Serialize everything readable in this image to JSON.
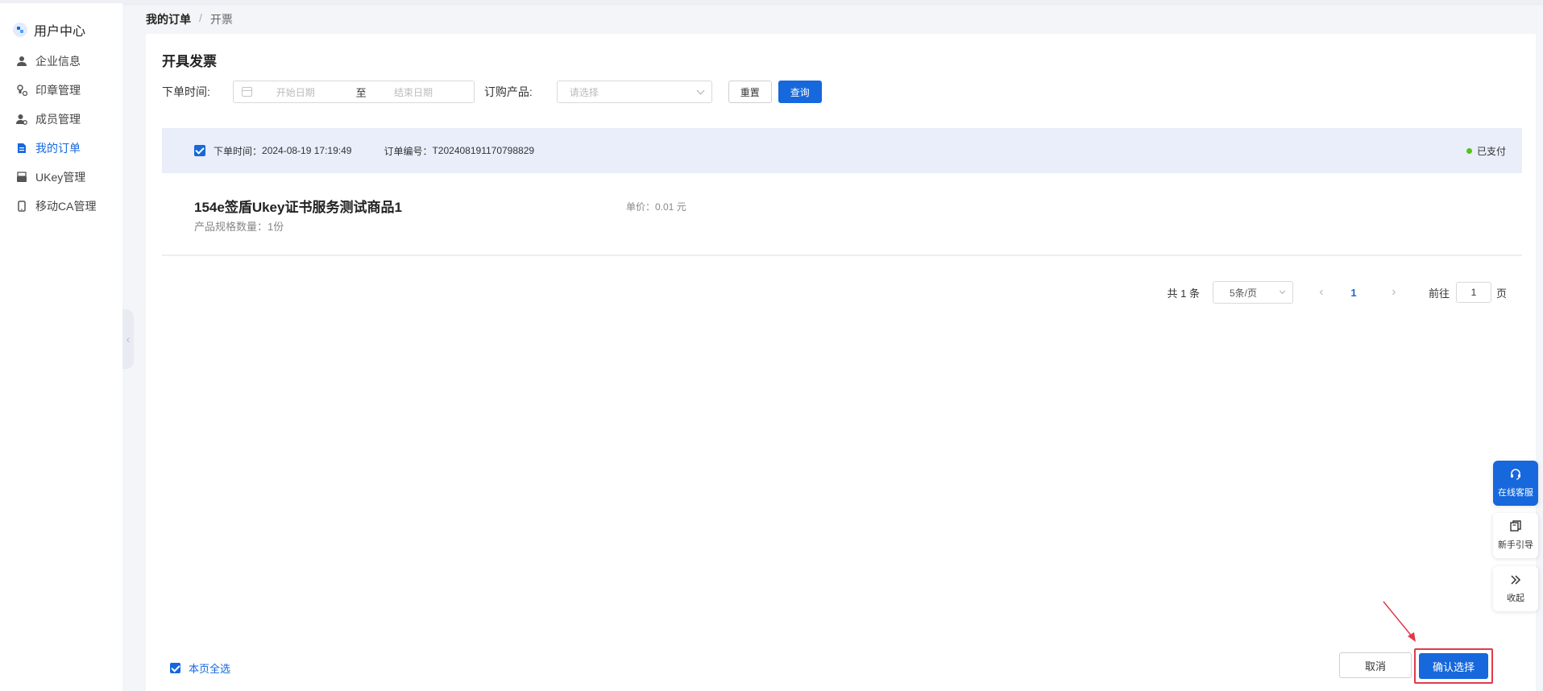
{
  "sidebar": {
    "title": "用户中心",
    "items": [
      {
        "label": "企业信息",
        "icon": "user-icon",
        "active": false
      },
      {
        "label": "印章管理",
        "icon": "seal-icon",
        "active": false
      },
      {
        "label": "成员管理",
        "icon": "members-icon",
        "active": false
      },
      {
        "label": "我的订单",
        "icon": "document-icon",
        "active": true
      },
      {
        "label": "UKey管理",
        "icon": "ukey-icon",
        "active": false
      },
      {
        "label": "移动CA管理",
        "icon": "mobile-icon",
        "active": false
      }
    ]
  },
  "breadcrumb": {
    "parent": "我的订单",
    "separator": "/",
    "current": "开票"
  },
  "page": {
    "title": "开具发票"
  },
  "filters": {
    "order_time_label": "下单时间:",
    "start_placeholder": "开始日期",
    "range_separator": "至",
    "end_placeholder": "结束日期",
    "product_label": "订购产品:",
    "product_placeholder": "请选择",
    "reset_label": "重置",
    "query_label": "查询"
  },
  "order": {
    "time_label": "下单时间：",
    "time_value": "2024-08-19 17:19:49",
    "no_label": "订单编号：",
    "no_value": "T202408191170798829",
    "status": "已支付",
    "product_name": "154e签盾Ukey证书服务测试商品1",
    "spec_text": "产品规格数量：1份",
    "unit_price_text": "单价：0.01 元"
  },
  "pagination": {
    "total_text": "共 1 条",
    "page_size": "5条/页",
    "prev": "‹",
    "current_page": "1",
    "next": "›",
    "goto_label": "前往",
    "goto_value": "1",
    "page_suffix": "页"
  },
  "footer": {
    "select_all_label": "本页全选",
    "cancel_label": "取消",
    "confirm_label": "确认选择"
  },
  "float_widgets": {
    "service_label": "在线客服",
    "guide_label": "新手引导",
    "collapse_label": "收起"
  },
  "colors": {
    "primary": "#1668dc",
    "status_paid": "#52c41a",
    "highlight_red": "#e03a4a"
  }
}
